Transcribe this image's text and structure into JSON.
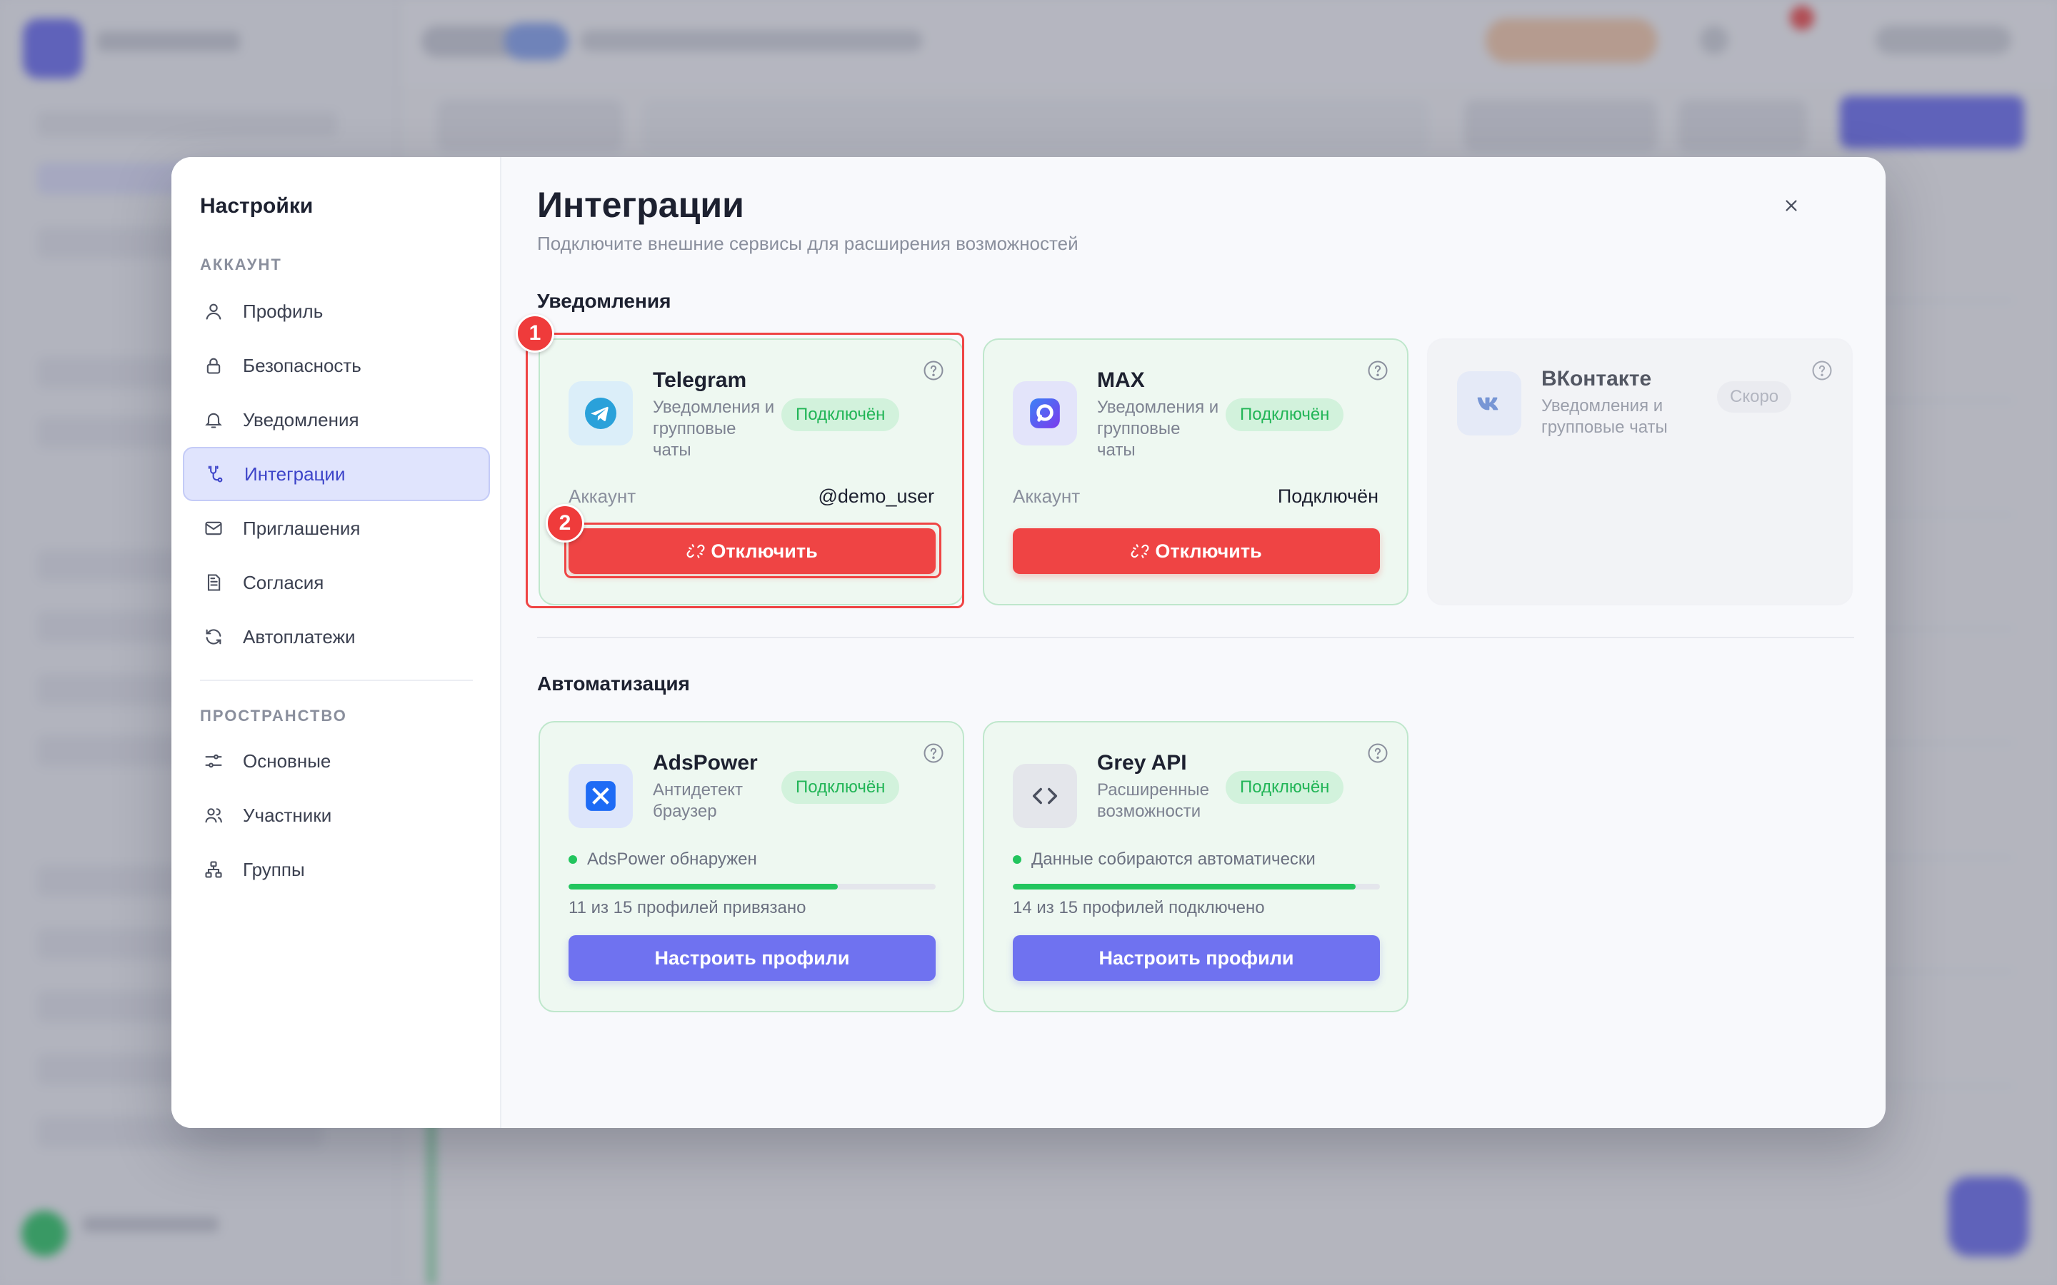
{
  "modal": {
    "sidebar_title": "Настройки",
    "groups": [
      {
        "label": "АККАУНТ",
        "items": [
          {
            "label": "Профиль",
            "icon": "user-icon"
          },
          {
            "label": "Безопасность",
            "icon": "lock-icon"
          },
          {
            "label": "Уведомления",
            "icon": "bell-icon"
          },
          {
            "label": "Интеграции",
            "icon": "integrations-icon",
            "active": true
          },
          {
            "label": "Приглашения",
            "icon": "mail-icon"
          },
          {
            "label": "Согласия",
            "icon": "document-icon"
          },
          {
            "label": "Автоплатежи",
            "icon": "refresh-icon"
          }
        ]
      },
      {
        "label": "ПРОСТРАНСТВО",
        "items": [
          {
            "label": "Основные",
            "icon": "sliders-icon"
          },
          {
            "label": "Участники",
            "icon": "users-icon"
          },
          {
            "label": "Группы",
            "icon": "hierarchy-icon"
          }
        ]
      }
    ],
    "title": "Интеграции",
    "subtitle": "Подключите внешние сервисы для расширения возможностей",
    "sections": {
      "notifications": {
        "title": "Уведомления",
        "cards": [
          {
            "name": "Telegram",
            "description": "Уведомления и групповые чаты",
            "badge": "Подключён",
            "account_label": "Аккаунт",
            "account_value": "@demo_user",
            "button": "Отключить",
            "icon": "telegram-icon"
          },
          {
            "name": "MAX",
            "description": "Уведомления и групповые чаты",
            "badge": "Подключён",
            "account_label": "Аккаунт",
            "account_value": "Подключён",
            "button": "Отключить",
            "icon": "max-icon"
          },
          {
            "name": "ВКонтакте",
            "description": "Уведомления и групповые чаты",
            "badge": "Скоро",
            "icon": "vk-icon"
          }
        ]
      },
      "automation": {
        "title": "Автоматизация",
        "cards": [
          {
            "name": "AdsPower",
            "description": "Антидетект браузер",
            "badge": "Подключён",
            "status": "AdsPower обнаружен",
            "progress_text": "11 из 15 профилей привязано",
            "progress": 0.733,
            "button": "Настроить профили",
            "icon": "adspower-icon"
          },
          {
            "name": "Grey API",
            "description": "Расширенные возможности",
            "badge": "Подключён",
            "status": "Данные собираются автоматически",
            "progress_text": "14 из 15 профилей подключено",
            "progress": 0.933,
            "button": "Настроить профили",
            "icon": "code-icon"
          }
        ]
      }
    },
    "annotations": [
      "1",
      "2"
    ]
  },
  "colors": {
    "accent": "#6366f1",
    "success": "#22c55e",
    "danger": "#ef4444"
  }
}
